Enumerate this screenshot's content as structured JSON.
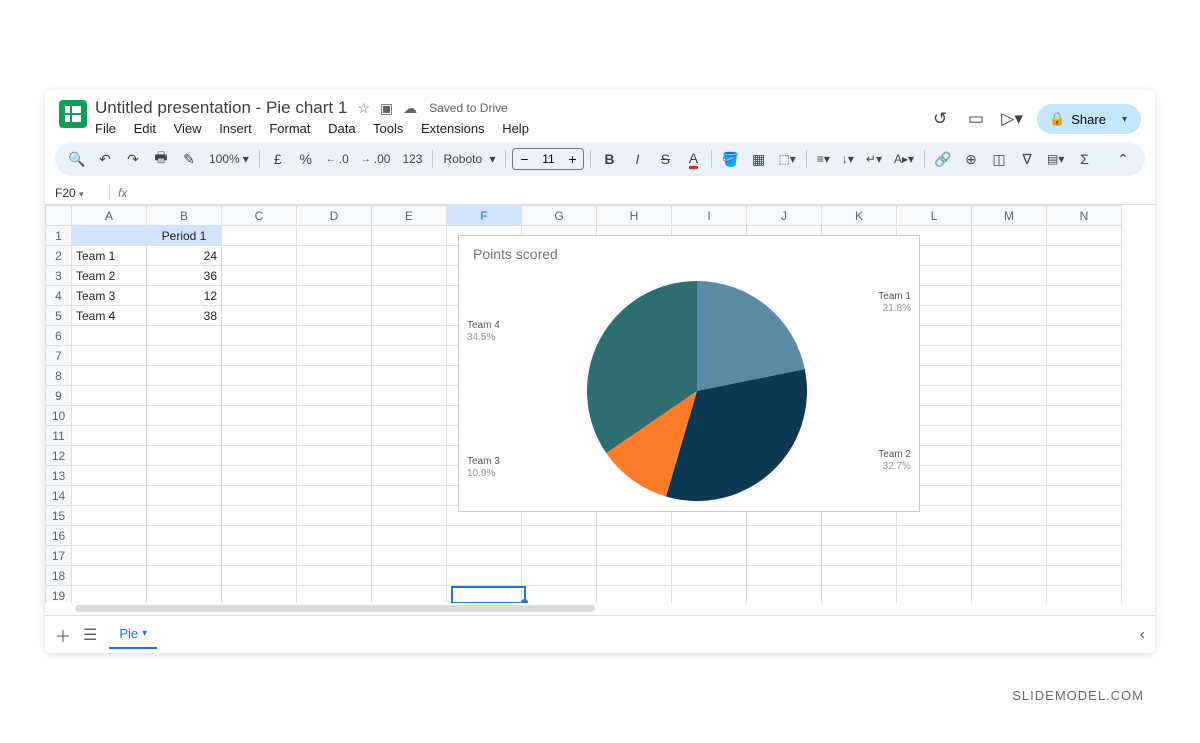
{
  "doc": {
    "title": "Untitled presentation - Pie chart 1",
    "saved": "Saved to Drive"
  },
  "menus": {
    "file": "File",
    "edit": "Edit",
    "view": "View",
    "insert": "Insert",
    "format": "Format",
    "data": "Data",
    "tools": "Tools",
    "extensions": "Extensions",
    "help": "Help"
  },
  "share": {
    "label": "Share"
  },
  "toolbar": {
    "zoom": "100%",
    "currency": "£",
    "percent": "%",
    "dec_dec": ".0",
    "inc_dec": ".00",
    "f123": "123",
    "font": "Roboto",
    "font_size": "11"
  },
  "namebox": {
    "cell": "F20"
  },
  "columns": [
    "A",
    "B",
    "C",
    "D",
    "E",
    "F",
    "G",
    "H",
    "I",
    "J",
    "K",
    "L",
    "M",
    "N"
  ],
  "rows_count": 25,
  "data": {
    "B1": "Period 1",
    "A2": "Team 1",
    "B2": "24",
    "A3": "Team 2",
    "B3": "36",
    "A4": "Team 3",
    "B4": "12",
    "A5": "Team 4",
    "B5": "38"
  },
  "active_col_index": 5,
  "active_row_index": 20,
  "sheet": {
    "name": "Pie"
  },
  "watermark": "SLIDEMODEL.COM",
  "chart_data": {
    "type": "pie",
    "title": "Points scored",
    "series": [
      {
        "name": "Team 1",
        "value": 24,
        "pct": "21.8%",
        "color": "#5b8ba6"
      },
      {
        "name": "Team 2",
        "value": 36,
        "pct": "32.7%",
        "color": "#0b3954"
      },
      {
        "name": "Team 3",
        "value": 12,
        "pct": "10.9%",
        "color": "#ff7c2b"
      },
      {
        "name": "Team 4",
        "value": 38,
        "pct": "34.5%",
        "color": "#2e6e73"
      }
    ]
  }
}
